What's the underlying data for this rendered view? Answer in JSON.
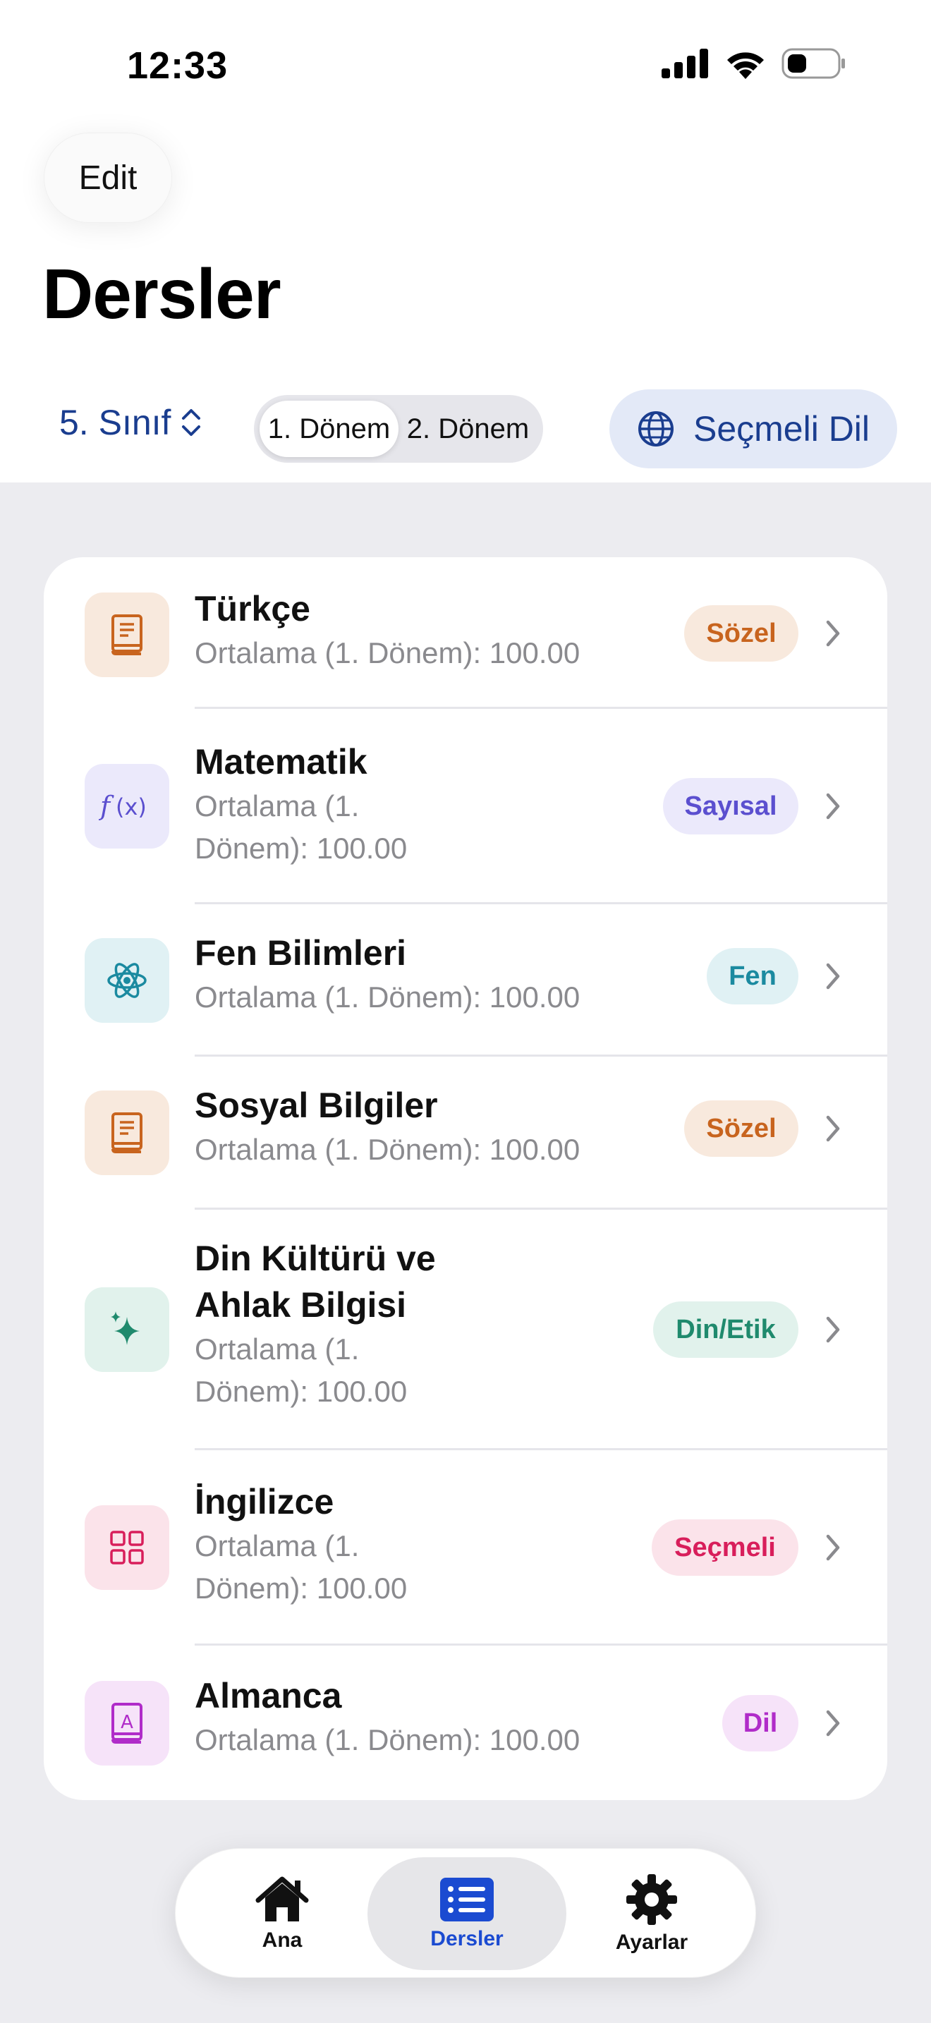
{
  "status_bar": {
    "time": "12:33",
    "icons": [
      "cellular-signal-icon",
      "wifi-icon",
      "battery-icon"
    ]
  },
  "header": {
    "edit_label": "Edit",
    "title": "Dersler"
  },
  "controls": {
    "grade_label": "5. Sınıf",
    "terms": [
      "1. Dönem",
      "2. Dönem"
    ],
    "selected_term": "1. Dönem",
    "language_button": "Seçmeli Dil"
  },
  "courses": [
    {
      "name": "Türkçe",
      "avg": "Ortalama (1. Dönem): 100.00",
      "badge": "Sözel",
      "icon": "book-icon",
      "color": "#c8641e",
      "bg": "#f8e9dd"
    },
    {
      "name": "Matematik",
      "avg_line1": "Ortalama (1.",
      "avg_line2": "Dönem): 100.00",
      "badge": "Sayısal",
      "icon": "function-icon",
      "color": "#5b4fcf",
      "bg": "#ebe9fb"
    },
    {
      "name": "Fen Bilimleri",
      "avg": "Ortalama (1. Dönem): 100.00",
      "badge": "Fen",
      "icon": "atom-icon",
      "color": "#1b8aa0",
      "bg": "#e0f1f4"
    },
    {
      "name": "Sosyal Bilgiler",
      "avg": "Ortalama (1. Dönem): 100.00",
      "badge": "Sözel",
      "icon": "book-icon",
      "color": "#c8641e",
      "bg": "#f8e9dd"
    },
    {
      "name_line1": "Din Kültürü ve",
      "name_line2": "Ahlak Bilgisi",
      "avg_line1": "Ortalama (1.",
      "avg_line2": "Dönem): 100.00",
      "badge": "Din/Etik",
      "icon": "sparkles-icon",
      "color": "#1f8a6d",
      "bg": "#e1f2ec"
    },
    {
      "name": "İngilizce",
      "avg_line1": "Ortalama (1.",
      "avg_line2": "Dönem): 100.00",
      "badge": "Seçmeli",
      "icon": "grid-icon",
      "color": "#d81e5b",
      "bg": "#fbe3ea"
    },
    {
      "name": "Almanca",
      "avg": "Ortalama (1. Dönem): 100.00",
      "badge": "Dil",
      "icon": "letter-book-icon",
      "color": "#b02cc9",
      "bg": "#f6e3f9"
    }
  ],
  "tabbar": {
    "tabs": [
      {
        "label": "Ana",
        "icon": "house-icon"
      },
      {
        "label": "Dersler",
        "icon": "list-icon"
      },
      {
        "label": "Ayarlar",
        "icon": "gear-icon"
      }
    ],
    "active": "Dersler",
    "active_color": "#1b4bd1"
  }
}
